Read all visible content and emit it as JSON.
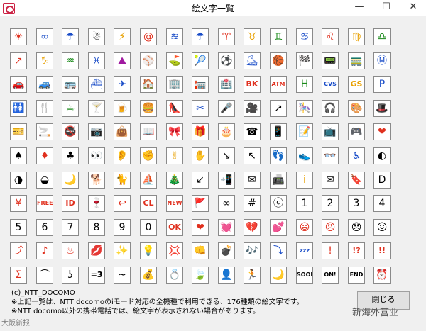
{
  "window": {
    "title": "絵文字一覧",
    "minimize": "—",
    "maximize": "☐",
    "close": "✕"
  },
  "emoji_rows": [
    [
      {
        "g": "☀",
        "c": "#e0301e",
        "n": "sun"
      },
      {
        "g": "∞",
        "c": "#1a4dc8",
        "n": "cloud"
      },
      {
        "g": "☂",
        "c": "#1a4dc8",
        "n": "umbrella"
      },
      {
        "g": "☃",
        "c": "#000",
        "n": "snowman"
      },
      {
        "g": "⚡",
        "c": "#e8a000",
        "n": "thunder"
      },
      {
        "g": "@",
        "c": "#e0301e",
        "n": "typhoon"
      },
      {
        "g": "≋",
        "c": "#1a4dc8",
        "n": "fog"
      },
      {
        "g": "☂",
        "c": "#1a4dc8",
        "n": "drizzle"
      },
      {
        "g": "♈",
        "c": "#e0301e",
        "n": "aries"
      },
      {
        "g": "♉",
        "c": "#e8a000",
        "n": "taurus"
      },
      {
        "g": "♊",
        "c": "#1a8a1a",
        "n": "gemini"
      },
      {
        "g": "♋",
        "c": "#1a4dc8",
        "n": "cancer"
      },
      {
        "g": "♌",
        "c": "#e0301e",
        "n": "leo"
      },
      {
        "g": "♍",
        "c": "#e8a000",
        "n": "virgo"
      },
      {
        "g": "♎",
        "c": "#1a8a1a",
        "n": "libra"
      }
    ],
    [
      {
        "g": "↗",
        "c": "#e0301e",
        "n": "scorpio"
      },
      {
        "g": "♑",
        "c": "#e8a000",
        "n": "capricorn"
      },
      {
        "g": "♒",
        "c": "#1a8a1a",
        "n": "aquarius"
      },
      {
        "g": "♓",
        "c": "#1a4dc8",
        "n": "pisces"
      },
      {
        "g": "⛰",
        "c": "#a01aa0",
        "n": "sports"
      },
      {
        "g": "⚾",
        "c": "#000",
        "n": "baseball"
      },
      {
        "g": "⛳",
        "c": "#1a8a1a",
        "n": "golf"
      },
      {
        "g": "🎾",
        "c": "#1a8a1a",
        "n": "tennis"
      },
      {
        "g": "⚽",
        "c": "#000",
        "n": "soccer"
      },
      {
        "g": "⛸",
        "c": "#1a4dc8",
        "n": "ski"
      },
      {
        "g": "🏀",
        "c": "#e8a000",
        "n": "basketball"
      },
      {
        "g": "🏁",
        "c": "#000",
        "n": "motorsports"
      },
      {
        "g": "📟",
        "c": "#a01aa0",
        "n": "pager"
      },
      {
        "g": "🚃",
        "c": "#1a8a1a",
        "n": "train"
      },
      {
        "g": "Ⓜ",
        "c": "#1a4dc8",
        "n": "subway"
      }
    ],
    [
      {
        "g": "🚗",
        "c": "#000",
        "n": "car"
      },
      {
        "g": "🚙",
        "c": "#1a8a1a",
        "n": "rv"
      },
      {
        "g": "🚌",
        "c": "#1a4dc8",
        "n": "bus"
      },
      {
        "g": "⛴",
        "c": "#1a4dc8",
        "n": "ship"
      },
      {
        "g": "✈",
        "c": "#1a4dc8",
        "n": "airplane"
      },
      {
        "g": "🏠",
        "c": "#e0301e",
        "n": "house"
      },
      {
        "g": "🏢",
        "c": "#000",
        "n": "building"
      },
      {
        "g": "🏣",
        "c": "#e0301e",
        "n": "post-office"
      },
      {
        "g": "🏥",
        "c": "#000",
        "n": "hospital"
      },
      {
        "g": "BK",
        "c": "#e0301e",
        "n": "bank"
      },
      {
        "g": "ATM",
        "c": "#e0301e",
        "n": "atm"
      },
      {
        "g": "H",
        "c": "#1a8a1a",
        "n": "hotel"
      },
      {
        "g": "CVS",
        "c": "#1a4dc8",
        "n": "cvs"
      },
      {
        "g": "GS",
        "c": "#e8a000",
        "n": "gas-station"
      },
      {
        "g": "P",
        "c": "#1a4dc8",
        "n": "parking"
      }
    ],
    [
      {
        "g": "🚻",
        "c": "#000",
        "n": "signal"
      },
      {
        "g": "🍴",
        "c": "#000",
        "n": "toilet"
      },
      {
        "g": "☕",
        "c": "#1a8a1a",
        "n": "restaurant"
      },
      {
        "g": "🍸",
        "c": "#a01aa0",
        "n": "cafe"
      },
      {
        "g": "🍺",
        "c": "#e8a000",
        "n": "bar"
      },
      {
        "g": "🍔",
        "c": "#e8a000",
        "n": "beer"
      },
      {
        "g": "👠",
        "c": "#a01aa0",
        "n": "fast-food"
      },
      {
        "g": "✂",
        "c": "#1a4dc8",
        "n": "boutique"
      },
      {
        "g": "🎤",
        "c": "#000",
        "n": "hairsalon"
      },
      {
        "g": "🎥",
        "c": "#000",
        "n": "karaoke"
      },
      {
        "g": "↗",
        "c": "#000",
        "n": "movie"
      },
      {
        "g": "🎠",
        "c": "#e8a000",
        "n": "upwards"
      },
      {
        "g": "🎧",
        "c": "#1a4dc8",
        "n": "carousel"
      },
      {
        "g": "🎨",
        "c": "#a01aa0",
        "n": "music"
      },
      {
        "g": "🎩",
        "c": "#000",
        "n": "art"
      }
    ],
    [
      {
        "g": "🎫",
        "c": "#e8a000",
        "n": "drama"
      },
      {
        "g": "🚬",
        "c": "#000",
        "n": "event"
      },
      {
        "g": "🚭",
        "c": "#e0301e",
        "n": "ticket"
      },
      {
        "g": "📷",
        "c": "#000",
        "n": "smoking"
      },
      {
        "g": "👜",
        "c": "#e0301e",
        "n": "no-smoking"
      },
      {
        "g": "📖",
        "c": "#e8a000",
        "n": "camera"
      },
      {
        "g": "🎀",
        "c": "#e0301e",
        "n": "bag"
      },
      {
        "g": "🎁",
        "c": "#e0301e",
        "n": "book"
      },
      {
        "g": "🎂",
        "c": "#e0301e",
        "n": "ribbon"
      },
      {
        "g": "☎",
        "c": "#000",
        "n": "present"
      },
      {
        "g": "📱",
        "c": "#000",
        "n": "birthday"
      },
      {
        "g": "📝",
        "c": "#e8a000",
        "n": "telephone"
      },
      {
        "g": "📺",
        "c": "#e0301e",
        "n": "mobile-phone"
      },
      {
        "g": "🎮",
        "c": "#000",
        "n": "memo"
      },
      {
        "g": "❤",
        "c": "#e0301e",
        "n": "tv"
      }
    ],
    [
      {
        "g": "♠",
        "c": "#000",
        "n": "game"
      },
      {
        "g": "♦",
        "c": "#e0301e",
        "n": "cd"
      },
      {
        "g": "♣",
        "c": "#000",
        "n": "heart"
      },
      {
        "g": "👀",
        "c": "#000",
        "n": "spade"
      },
      {
        "g": "👂",
        "c": "#e8a000",
        "n": "diamond"
      },
      {
        "g": "✊",
        "c": "#e8a000",
        "n": "club"
      },
      {
        "g": "✌",
        "c": "#e8a000",
        "n": "eye"
      },
      {
        "g": "✋",
        "c": "#e8a000",
        "n": "ear"
      },
      {
        "g": "↘",
        "c": "#000",
        "n": "rock"
      },
      {
        "g": "↖",
        "c": "#000",
        "n": "scissors"
      },
      {
        "g": "👣",
        "c": "#000",
        "n": "paper"
      },
      {
        "g": "👟",
        "c": "#000",
        "n": "downright"
      },
      {
        "g": "👓",
        "c": "#000",
        "n": "upleft"
      },
      {
        "g": "♿",
        "c": "#1a4dc8",
        "n": "foot"
      },
      {
        "g": "◐",
        "c": "#000",
        "n": "shoe"
      }
    ],
    [
      {
        "g": "◑",
        "c": "#000",
        "n": "eyeglass"
      },
      {
        "g": "◒",
        "c": "#000",
        "n": "wheelchair"
      },
      {
        "g": "🌙",
        "c": "#000",
        "n": "newmoon"
      },
      {
        "g": "🐕",
        "c": "#e8a000",
        "n": "moon1"
      },
      {
        "g": "🐈",
        "c": "#e8a000",
        "n": "moon2"
      },
      {
        "g": "⛵",
        "c": "#1a4dc8",
        "n": "moon3"
      },
      {
        "g": "🎄",
        "c": "#1a8a1a",
        "n": "fullmoon"
      },
      {
        "g": "↙",
        "c": "#000",
        "n": "dog"
      },
      {
        "g": "📲",
        "c": "#000",
        "n": "cat"
      },
      {
        "g": "✉",
        "c": "#000",
        "n": "yacht"
      },
      {
        "g": "📠",
        "c": "#000",
        "n": "xmas"
      },
      {
        "g": "i",
        "c": "#e8a000",
        "n": "downleft"
      },
      {
        "g": "✉",
        "c": "#000",
        "n": "phoneto"
      },
      {
        "g": "🔖",
        "c": "#000",
        "n": "mailto"
      },
      {
        "g": "D",
        "c": "#000",
        "n": "faxto"
      }
    ],
    [
      {
        "g": "¥",
        "c": "#e0301e",
        "n": "info01"
      },
      {
        "g": "FREE",
        "c": "#e0301e",
        "n": "info02"
      },
      {
        "g": "ID",
        "c": "#e0301e",
        "n": "mail"
      },
      {
        "g": "🍷",
        "c": "#e0301e",
        "n": "by-d"
      },
      {
        "g": "↩",
        "c": "#e0301e",
        "n": "d-point"
      },
      {
        "g": "CL",
        "c": "#e0301e",
        "n": "yen"
      },
      {
        "g": "NEW",
        "c": "#e0301e",
        "n": "free"
      },
      {
        "g": "🚩",
        "c": "#e0301e",
        "n": "id"
      },
      {
        "g": "∞",
        "c": "#000",
        "n": "key"
      },
      {
        "g": "#",
        "c": "#000",
        "n": "enter"
      },
      {
        "g": "ⓒ",
        "c": "#000",
        "n": "clear"
      },
      {
        "g": "1",
        "c": "#000",
        "n": "search"
      },
      {
        "g": "2",
        "c": "#000",
        "n": "new"
      },
      {
        "g": "3",
        "c": "#000",
        "n": "flag"
      },
      {
        "g": "4",
        "c": "#000",
        "n": "freedial"
      }
    ],
    [
      {
        "g": "5",
        "c": "#000",
        "n": "sharp"
      },
      {
        "g": "6",
        "c": "#000",
        "n": "mobaq"
      },
      {
        "g": "7",
        "c": "#000",
        "n": "one"
      },
      {
        "g": "8",
        "c": "#000",
        "n": "two"
      },
      {
        "g": "9",
        "c": "#000",
        "n": "three"
      },
      {
        "g": "0",
        "c": "#000",
        "n": "four"
      },
      {
        "g": "OK",
        "c": "#e0301e",
        "n": "five"
      },
      {
        "g": "❤",
        "c": "#e0301e",
        "n": "six"
      },
      {
        "g": "💓",
        "c": "#e0301e",
        "n": "seven"
      },
      {
        "g": "💔",
        "c": "#e0301e",
        "n": "eight"
      },
      {
        "g": "💕",
        "c": "#e0301e",
        "n": "nine"
      },
      {
        "g": "😃",
        "c": "#e0301e",
        "n": "zero"
      },
      {
        "g": "😠",
        "c": "#e0301e",
        "n": "ok"
      },
      {
        "g": "😞",
        "c": "#000",
        "n": "heart01"
      },
      {
        "g": "😖",
        "c": "#000",
        "n": "heart02"
      }
    ],
    [
      {
        "g": "⤴",
        "c": "#e0301e",
        "n": "heart03"
      },
      {
        "g": "♪",
        "c": "#e0301e",
        "n": "heart04"
      },
      {
        "g": "♨",
        "c": "#e0301e",
        "n": "happy01"
      },
      {
        "g": "💋",
        "c": "#e0301e",
        "n": "angry"
      },
      {
        "g": "✨",
        "c": "#e8a000",
        "n": "despair"
      },
      {
        "g": "💡",
        "c": "#e8a000",
        "n": "sad"
      },
      {
        "g": "💢",
        "c": "#000",
        "n": "wobbly"
      },
      {
        "g": "👊",
        "c": "#e0301e",
        "n": "up"
      },
      {
        "g": "💣",
        "c": "#000",
        "n": "note"
      },
      {
        "g": "🎶",
        "c": "#e0301e",
        "n": "spa"
      },
      {
        "g": "⤵",
        "c": "#1a4dc8",
        "n": "cute"
      },
      {
        "g": "zzz",
        "c": "#1a4dc8",
        "n": "kissmark"
      },
      {
        "g": "!",
        "c": "#e0301e",
        "n": "shine"
      },
      {
        "g": "!?",
        "c": "#e0301e",
        "n": "flair"
      },
      {
        "g": "!!",
        "c": "#e0301e",
        "n": "annoy"
      }
    ],
    [
      {
        "g": "Σ",
        "c": "#e0301e",
        "n": "punch"
      },
      {
        "g": "⌒",
        "c": "#000",
        "n": "bomb"
      },
      {
        "g": "ʖ",
        "c": "#000",
        "n": "notes"
      },
      {
        "g": "=3",
        "c": "#000",
        "n": "down"
      },
      {
        "g": "~",
        "c": "#000",
        "n": "sleepy"
      },
      {
        "g": "💰",
        "c": "#000",
        "n": "sign01"
      },
      {
        "g": "💍",
        "c": "#000",
        "n": "sign02"
      },
      {
        "g": "🍃",
        "c": "#000",
        "n": "sign03"
      },
      {
        "g": "👤",
        "c": "#000",
        "n": "impact"
      },
      {
        "g": "🏃",
        "c": "#000",
        "n": "sweat01"
      },
      {
        "g": "🌙",
        "c": "#000",
        "n": "sweat02"
      },
      {
        "g": "SOON",
        "c": "#000",
        "n": "dash"
      },
      {
        "g": "ON!",
        "c": "#000",
        "n": "sign04"
      },
      {
        "g": "END",
        "c": "#000",
        "n": "sign05"
      },
      {
        "g": "⏰",
        "c": "#000",
        "n": "slate"
      }
    ]
  ],
  "footer": {
    "copyright": "(c)_NTT_DOCOMO",
    "note1": "※上記一覧は、NTT docomoのiモード対応の全機種で利用できる、176種類の絵文字です。",
    "note2": "※NTT docomo以外の携帯電話では、絵文字が表示されない場合があります。"
  },
  "close_button": "閉じる",
  "watermark": "新海外营业",
  "watermark_left": "大阪新报"
}
